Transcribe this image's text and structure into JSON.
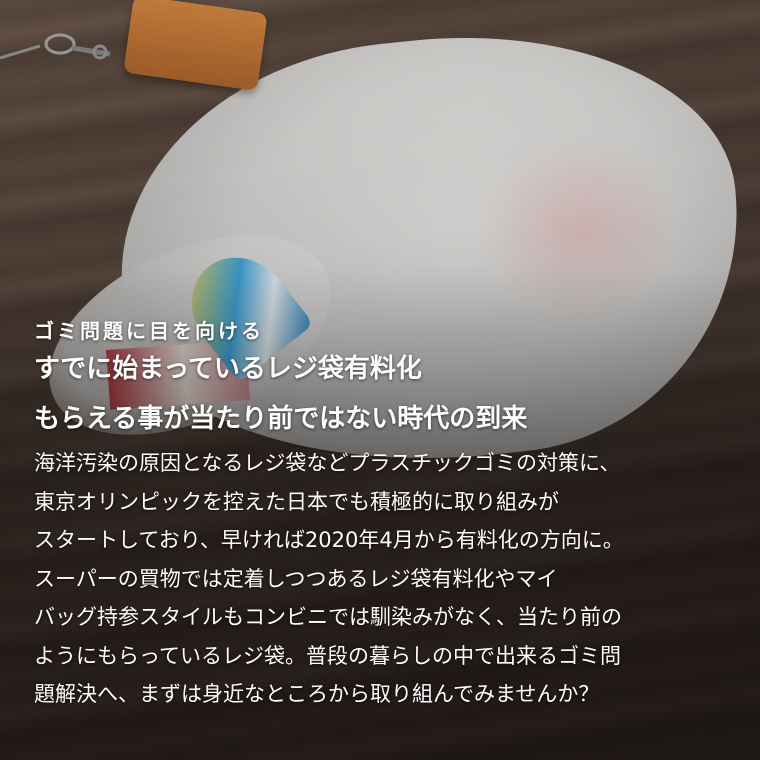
{
  "subtitle": "ゴミ問題に目を向ける",
  "headline": [
    "すでに始まっているレジ袋有料化",
    "もらえる事が当たり前ではない時代の到来"
  ],
  "body": [
    "海洋汚染の原因となるレジ袋などプラスチックゴミの対策に、",
    "東京オリンピックを控えた日本でも積極的に取り組みが",
    "スタートしており、早ければ2020年4月から有料化の方向に。",
    "スーパーの買物では定着しつつあるレジ袋有料化やマイ",
    "バッグ持参スタイルもコンビニでは馴染みがなく、当たり前の",
    "ようにもらっているレジ袋。普段の暮らしの中で出来るゴミ問",
    "題解決へ、まずは身近なところから取り組んでみませんか？"
  ],
  "colors": {
    "text": "#ffffff",
    "wood": "#5b4a3f",
    "wallet": "#b06a30"
  }
}
